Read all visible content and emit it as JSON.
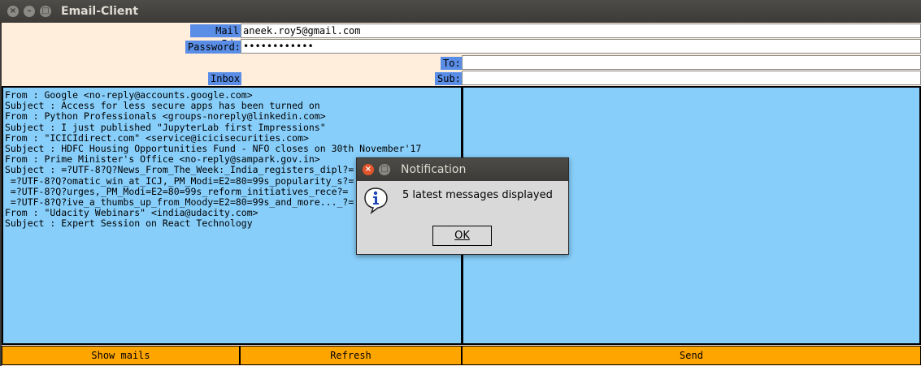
{
  "window": {
    "title": "Email-Client",
    "close_glyph": "×",
    "min_glyph": "–",
    "max_glyph": "□"
  },
  "form": {
    "mail_id_label": "Mail Id:",
    "mail_id_value": "aneek.roy5@gmail.com",
    "password_label": "Password:",
    "password_value": "••••••••••••",
    "to_label": "To:",
    "to_value": "",
    "inbox_label": "Inbox",
    "sub_label": "Sub:",
    "sub_value": ""
  },
  "inbox": {
    "lines": [
      "From : Google <no-reply@accounts.google.com>",
      "Subject : Access for less secure apps has been turned on",
      "From : Python Professionals <groups-noreply@linkedin.com>",
      "Subject : I just published \"JupyterLab first Impressions\"",
      "From : \"ICICIdirect.com\" <service@icicisecurities.com>",
      "Subject : HDFC Housing Opportunities Fund - NFO closes on 30th November'17",
      "From : Prime Minister's Office <no-reply@sampark.gov.in>",
      "Subject : =?UTF-8?Q?News_From_The_Week:_India_registers_dipl?=",
      " =?UTF-8?Q?omatic_win_at_ICJ,_PM_Modi=E2=80=99s_popularity_s?=",
      " =?UTF-8?Q?urges,_PM_Modi=E2=80=99s_reform_initiatives_rece?=",
      " =?UTF-8?Q?ive_a_thumbs_up_from_Moody=E2=80=99s_and_more..._?=",
      "From : \"Udacity Webinars\" <india@udacity.com>",
      "Subject : Expert Session on React Technology"
    ]
  },
  "buttons": {
    "show_mails": "Show mails",
    "refresh": "Refresh",
    "send": "Send"
  },
  "dialog": {
    "title": "Notification",
    "close_glyph": "×",
    "max_glyph": "□",
    "message": "5 latest messages displayed",
    "ok_label": "OK",
    "icon": "info-icon"
  },
  "colors": {
    "pane": "#87cefa",
    "button": "#ffa500",
    "label": "#5a8ee6",
    "form_bg": "#ffeedb"
  }
}
